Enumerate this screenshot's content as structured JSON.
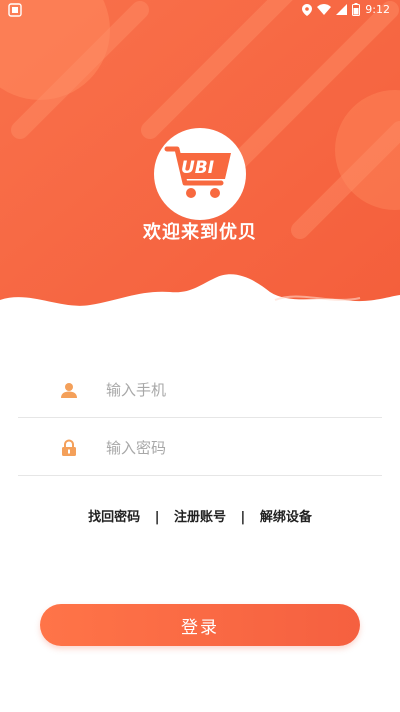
{
  "status_bar": {
    "time": "9:12",
    "icons": [
      "app-notification-icon",
      "location-icon",
      "wifi-icon",
      "signal-icon",
      "battery-icon"
    ]
  },
  "logo": {
    "text": "UBI"
  },
  "welcome": "欢迎来到优贝",
  "form": {
    "phone_placeholder": "输入手机",
    "password_placeholder": "输入密码"
  },
  "links": {
    "find_password": "找回密码",
    "register": "注册账号",
    "unbind": "解绑设备",
    "separator": "|"
  },
  "login_button": "登录",
  "colors": {
    "brand_orange": "#f8693f",
    "icon_orange": "#f4a05a",
    "button_start": "#ff7448",
    "button_end": "#f56040"
  }
}
